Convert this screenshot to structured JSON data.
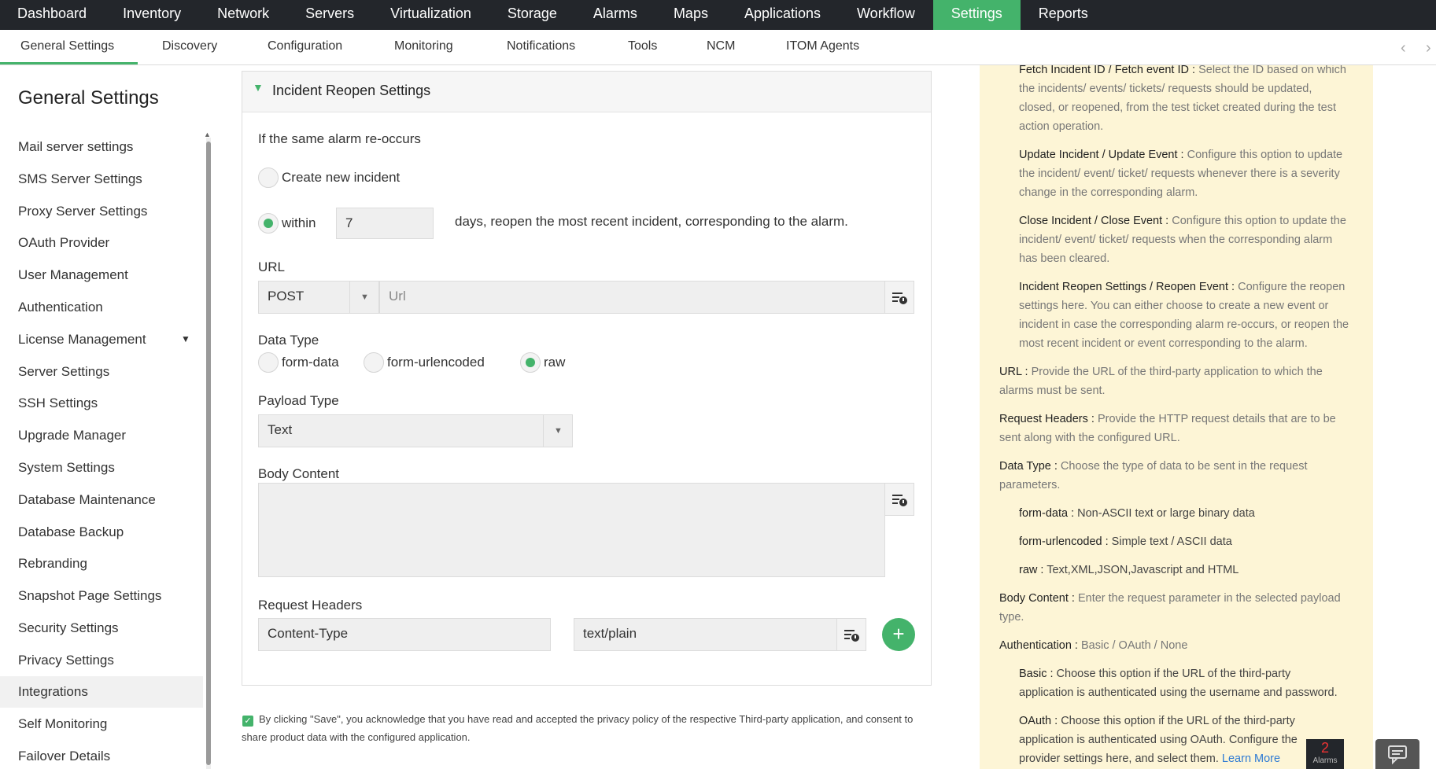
{
  "topnav": [
    "Dashboard",
    "Inventory",
    "Network",
    "Servers",
    "Virtualization",
    "Storage",
    "Alarms",
    "Maps",
    "Applications",
    "Workflow",
    "Settings",
    "Reports"
  ],
  "subnav": [
    "General Settings",
    "Discovery",
    "Configuration",
    "Monitoring",
    "Notifications",
    "Tools",
    "NCM",
    "ITOM Agents"
  ],
  "sidebar": {
    "title": "General Settings",
    "items": [
      "Mail server settings",
      "SMS Server Settings",
      "Proxy Server Settings",
      "OAuth Provider",
      "User Management",
      "Authentication",
      "License Management",
      "Server Settings",
      "SSH Settings",
      "Upgrade Manager",
      "System Settings",
      "Database Maintenance",
      "Database Backup",
      "Rebranding",
      "Snapshot Page Settings",
      "Security Settings",
      "Privacy Settings",
      "Integrations",
      "Self Monitoring",
      "Failover Details"
    ],
    "active": "Integrations"
  },
  "form": {
    "section_title": "Incident Reopen Settings",
    "recur_label": "If the same alarm re-occurs",
    "opt_new": "Create new incident",
    "opt_within": "within",
    "days_value": "7",
    "days_suffix": "days, reopen the most recent incident, corresponding to the alarm.",
    "url_label": "URL",
    "method_value": "POST",
    "url_placeholder": "Url",
    "datatype_label": "Data Type",
    "datatypes": [
      "form-data",
      "form-urlencoded",
      "raw"
    ],
    "datatype_selected": "raw",
    "payload_label": "Payload Type",
    "payload_value": "Text",
    "body_label": "Body Content",
    "headers_label": "Request Headers",
    "header_key": "Content-Type",
    "header_value": "text/plain",
    "consent_line1": "By clicking \"Save\", you acknowledge that you have read and accepted the privacy policy of the respective Third-party application, and consent to",
    "consent_line2": "share product data with the configured application."
  },
  "help": {
    "fetch_term": "Fetch Incident ID / Fetch event ID :",
    "fetch_desc_1": "Select the ID based on which",
    "fetch_desc_2": "the incidents/ events/ tickets/ requests should be updated,",
    "fetch_desc_3": "closed, or reopened, from the test ticket created during the test",
    "fetch_desc_4": "action operation.",
    "update_term": "Update Incident / Update Event :",
    "update_desc_1": "Configure this option to update",
    "update_desc_2": "the incident/ event/ ticket/ requests whenever there is a severity",
    "update_desc_3": "change in the corresponding alarm.",
    "close_term": "Close Incident / Close Event :",
    "close_desc_1": "Configure this option to update the",
    "close_desc_2": "incident/ event/ ticket/ requests when the corresponding alarm",
    "close_desc_3": "has been cleared.",
    "reopen_term": "Incident Reopen Settings / Reopen Event :",
    "reopen_desc_1": "Configure the reopen",
    "reopen_desc_2": "settings here. You can either choose to create a new event or",
    "reopen_desc_3": "incident in case the corresponding alarm re-occurs, or reopen the",
    "reopen_desc_4": "most recent incident or event corresponding to the alarm.",
    "url_term": "URL :",
    "url_desc_1": "Provide the URL of the third-party application to which the",
    "url_desc_2": "alarms must be sent.",
    "rh_term": "Request Headers :",
    "rh_desc_1": "Provide the HTTP request details that are to be",
    "rh_desc_2": "sent along with the configured URL.",
    "dt_term": "Data Type :",
    "dt_desc_1": "Choose the type of data to be sent in the request",
    "dt_desc_2": "parameters.",
    "fd_term": "form-data :",
    "fd_desc": "Non-ASCII text or large binary data",
    "fu_term": "form-urlencoded :",
    "fu_desc": "Simple text / ASCII data",
    "raw_term": "raw :",
    "raw_desc": "Text,XML,JSON,Javascript and HTML",
    "bc_term": "Body Content :",
    "bc_desc_1": "Enter the request parameter in the selected payload",
    "bc_desc_2": "type.",
    "auth_term": "Authentication :",
    "auth_desc": "Basic / OAuth / None",
    "basic_term": "Basic :",
    "basic_desc_1": "Choose this option if the URL of the third-party",
    "basic_desc_2": "application is authenticated using the username and password.",
    "oauth_term": "OAuth :",
    "oauth_desc_1": "Choose this option if the URL of the third-party",
    "oauth_desc_2": "application is authenticated using OAuth. Configure the",
    "oauth_desc_3": "provider settings here, and select them.",
    "learn_more": "Learn More"
  },
  "alarms": {
    "count": "2",
    "label": "Alarms"
  },
  "colors": {
    "accent": "#44b36b",
    "nav_bg": "#23262b",
    "help_bg": "#fdf5d6"
  }
}
